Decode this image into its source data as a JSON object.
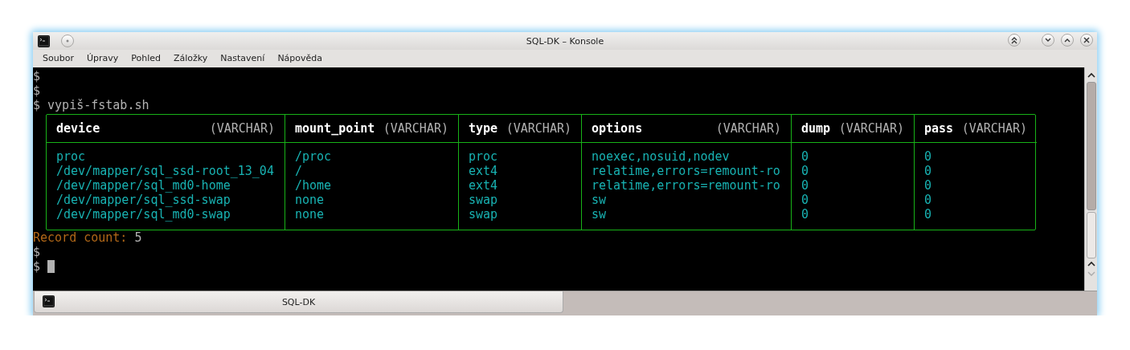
{
  "window": {
    "title": "SQL-DK – Konsole"
  },
  "menu": [
    "Soubor",
    "Úpravy",
    "Pohled",
    "Záložky",
    "Nastavení",
    "Nápověda"
  ],
  "terminal": {
    "lines_before": [
      "$",
      "$",
      "$ vypiš-fstab.sh"
    ],
    "table": {
      "columns": [
        {
          "name": "device",
          "type": "(VARCHAR)"
        },
        {
          "name": "mount_point",
          "type": "(VARCHAR)"
        },
        {
          "name": "type",
          "type": "(VARCHAR)"
        },
        {
          "name": "options",
          "type": "(VARCHAR)"
        },
        {
          "name": "dump",
          "type": "(VARCHAR)"
        },
        {
          "name": "pass",
          "type": "(VARCHAR)"
        }
      ],
      "rows": [
        [
          "proc",
          "/proc",
          "proc",
          "noexec,nosuid,nodev",
          "0",
          "0"
        ],
        [
          "/dev/mapper/sql_ssd-root_13_04",
          "/",
          "ext4",
          "relatime,errors=remount-ro",
          "0",
          "0"
        ],
        [
          "/dev/mapper/sql_md0-home",
          "/home",
          "ext4",
          "relatime,errors=remount-ro",
          "0",
          "0"
        ],
        [
          "/dev/mapper/sql_ssd-swap",
          "none",
          "swap",
          "sw",
          "0",
          "0"
        ],
        [
          "/dev/mapper/sql_md0-swap",
          "none",
          "swap",
          "sw",
          "0",
          "0"
        ]
      ]
    },
    "record_count": {
      "label": "Record count:",
      "value": "5"
    },
    "lines_after": [
      "$",
      "$"
    ]
  },
  "tabs": [
    {
      "label": "SQL-DK",
      "selected": true
    }
  ]
}
